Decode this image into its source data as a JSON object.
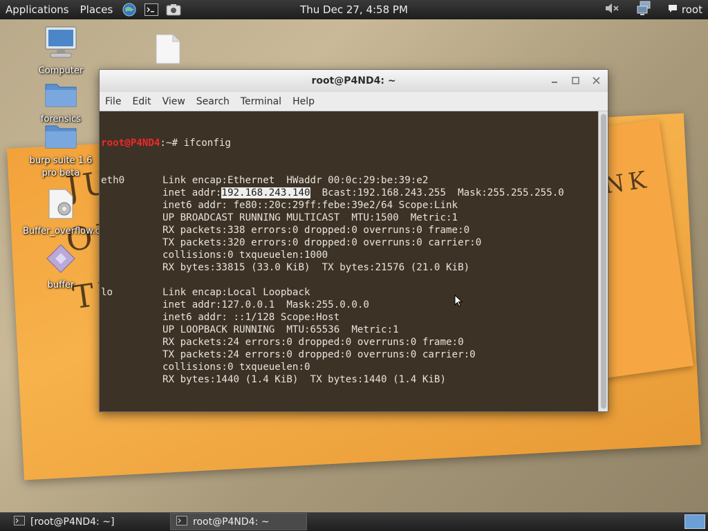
{
  "top_panel": {
    "menus": [
      "Applications",
      "Places"
    ],
    "launchers": [
      "web-browser-icon",
      "terminal-icon",
      "screenshot-icon"
    ],
    "clock": "Thu Dec 27,  4:58 PM",
    "tray_icons": [
      "volume-muted-icon",
      "network-icon"
    ],
    "user": "root"
  },
  "desktop": {
    "icons": [
      {
        "label": "Computer",
        "icon": "computer-icon"
      },
      {
        "label": "forensics",
        "icon": "folder-icon"
      },
      {
        "label": "burp suite 1.6 pro beta",
        "icon": "folder-icon"
      },
      {
        "label": "Buffer_overflow.c",
        "icon": "text-file-icon"
      },
      {
        "label": "buffer",
        "icon": "executable-icon"
      },
      {
        "label": "",
        "icon": "blank-file-icon"
      }
    ],
    "wallpaper_text": [
      "JUST",
      "OUT OF",
      "THE",
      "THINK"
    ]
  },
  "terminal": {
    "title": "root@P4ND4: ~",
    "menus": [
      "File",
      "Edit",
      "View",
      "Search",
      "Terminal",
      "Help"
    ],
    "prompt_user": "root@P4ND4",
    "prompt_path": ":~",
    "prompt_symbol": "# ",
    "command": "ifconfig",
    "output": [
      {
        "iface": "eth0",
        "text": "Link encap:Ethernet  HWaddr 00:0c:29:be:39:e2"
      },
      {
        "iface": "",
        "text": "inet addr:",
        "selected": "192.168.243.140",
        "after": "  Bcast:192.168.243.255  Mask:255.255.255.0"
      },
      {
        "iface": "",
        "text": "inet6 addr: fe80::20c:29ff:febe:39e2/64 Scope:Link"
      },
      {
        "iface": "",
        "text": "UP BROADCAST RUNNING MULTICAST  MTU:1500  Metric:1"
      },
      {
        "iface": "",
        "text": "RX packets:338 errors:0 dropped:0 overruns:0 frame:0"
      },
      {
        "iface": "",
        "text": "TX packets:320 errors:0 dropped:0 overruns:0 carrier:0"
      },
      {
        "iface": "",
        "text": "collisions:0 txqueuelen:1000"
      },
      {
        "iface": "",
        "text": "RX bytes:33815 (33.0 KiB)  TX bytes:21576 (21.0 KiB)"
      },
      {
        "iface": "",
        "text": ""
      },
      {
        "iface": "lo",
        "text": "Link encap:Local Loopback"
      },
      {
        "iface": "",
        "text": "inet addr:127.0.0.1  Mask:255.0.0.0"
      },
      {
        "iface": "",
        "text": "inet6 addr: ::1/128 Scope:Host"
      },
      {
        "iface": "",
        "text": "UP LOOPBACK RUNNING  MTU:65536  Metric:1"
      },
      {
        "iface": "",
        "text": "RX packets:24 errors:0 dropped:0 overruns:0 frame:0"
      },
      {
        "iface": "",
        "text": "TX packets:24 errors:0 dropped:0 overruns:0 carrier:0"
      },
      {
        "iface": "",
        "text": "collisions:0 txqueuelen:0"
      },
      {
        "iface": "",
        "text": "RX bytes:1440 (1.4 KiB)  TX bytes:1440 (1.4 KiB)"
      },
      {
        "iface": "",
        "text": ""
      }
    ]
  },
  "taskbar": {
    "tasks": [
      {
        "label": "[root@P4ND4: ~]",
        "active": false
      },
      {
        "label": "root@P4ND4: ~",
        "active": true
      }
    ]
  },
  "colors": {
    "prompt": "#ef2929",
    "panel": "#2a2a2a",
    "terminal_bg": "#24180a"
  }
}
